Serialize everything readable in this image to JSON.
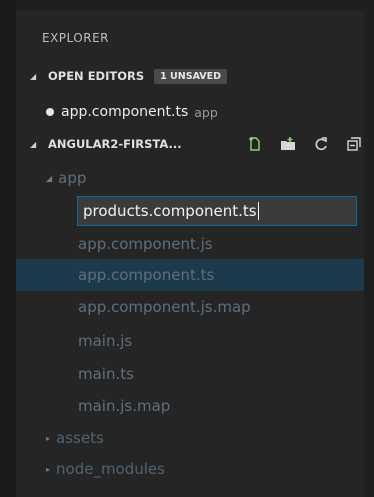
{
  "explorer": {
    "title": "EXPLORER"
  },
  "open_editors": {
    "label": "OPEN EDITORS",
    "badge": "1 UNSAVED",
    "items": [
      {
        "name": "app.component.ts",
        "dir": "app"
      }
    ]
  },
  "project": {
    "label": "ANGULAR2-FIRSTA...",
    "actions": [
      "new-file-icon",
      "new-folder-icon",
      "refresh-icon",
      "collapse-all-icon"
    ]
  },
  "tree": {
    "folder": "app",
    "rename_value": "products.component.ts",
    "files": [
      "app.component.js",
      "app.component.ts",
      "app.component.js.map",
      "main.js",
      "main.ts",
      "main.js.map"
    ],
    "selected_file_index": 1,
    "folders_below": [
      "assets",
      "node_modules"
    ]
  },
  "colors": {
    "background": "#252526",
    "selection": "#1d3a4c",
    "input_border": "#0a6aa8",
    "dim_text": "#5f6f7a"
  }
}
